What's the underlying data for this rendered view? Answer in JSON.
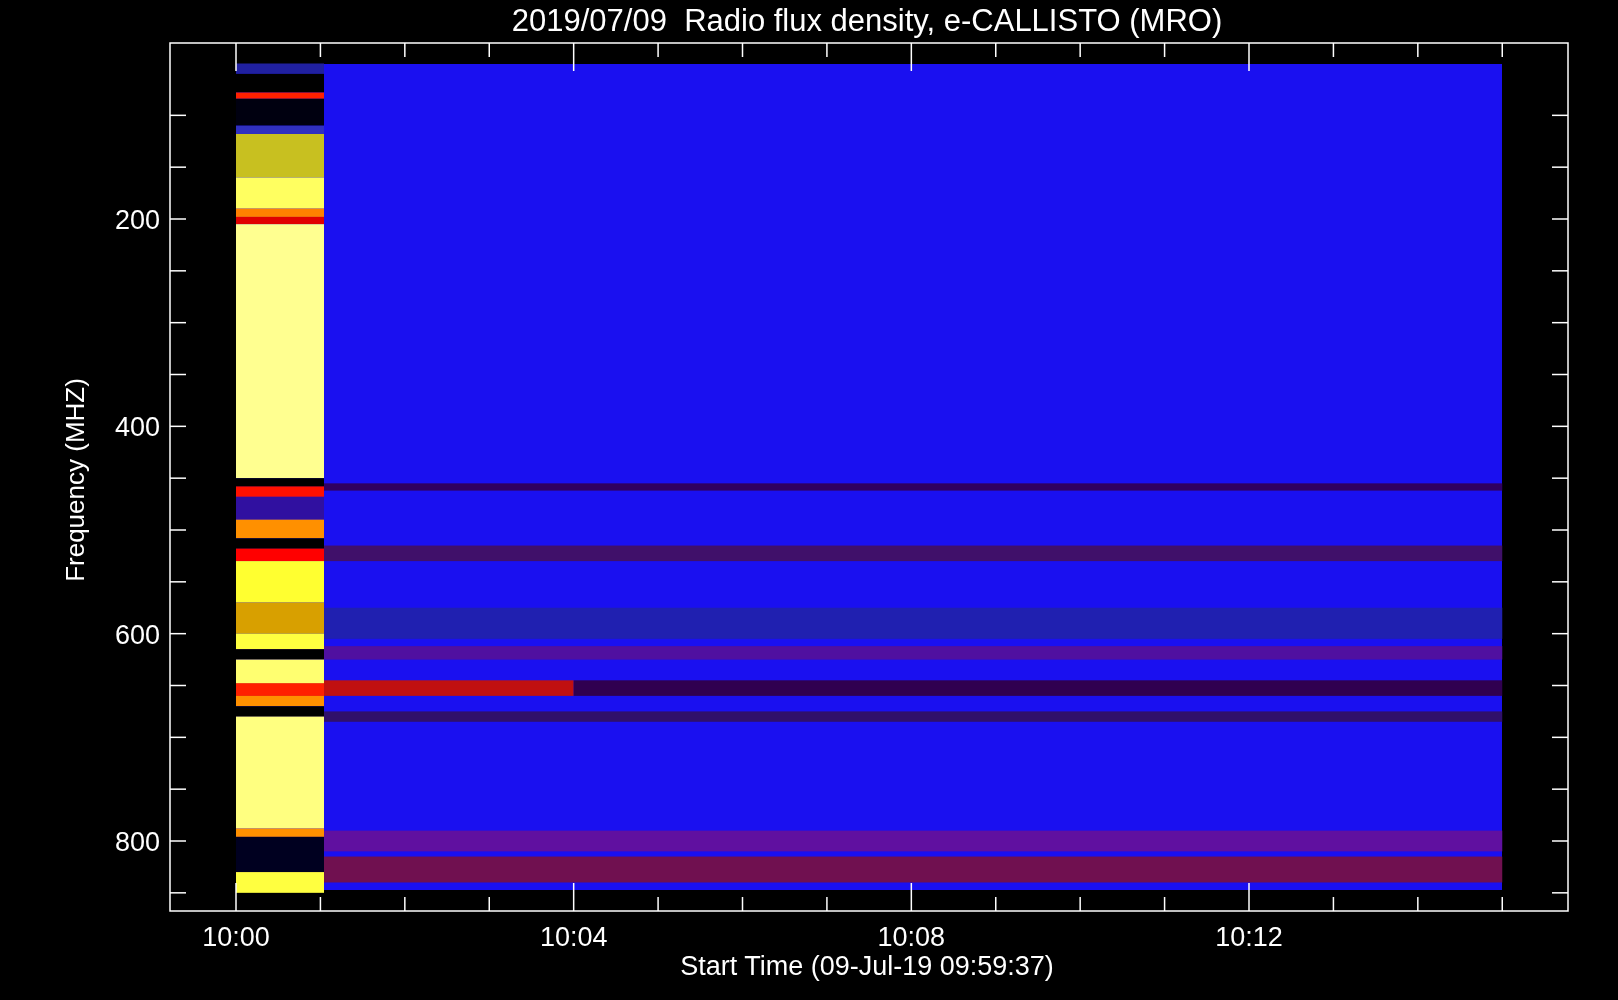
{
  "title": "2019/07/09  Radio flux density, e-CALLISTO (MRO)",
  "y_axis": {
    "label": "Frequency (MHZ)",
    "ticks": [
      "200",
      "400",
      "600",
      "800"
    ]
  },
  "x_axis": {
    "label": "Start Time (09-Jul-19 09:59:37)",
    "ticks": [
      "10:00",
      "10:04",
      "10:08",
      "10:12"
    ]
  }
}
